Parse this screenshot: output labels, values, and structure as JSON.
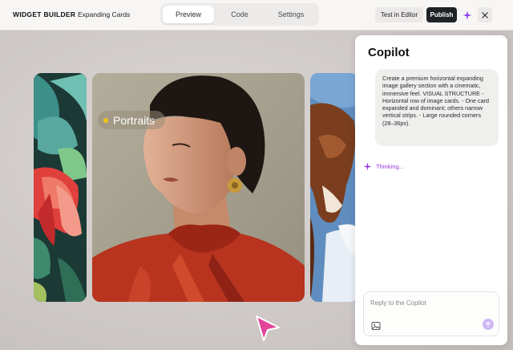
{
  "topbar": {
    "brand": "WIDGET BUILDER",
    "project": "Expanding Cards",
    "tabs": [
      {
        "label": "Preview",
        "active": true
      },
      {
        "label": "Code",
        "active": false
      },
      {
        "label": "Settings",
        "active": false
      }
    ],
    "test_label": "Test in Editor",
    "publish_label": "Publish",
    "icons": {
      "spark": "sparkle-icon",
      "close": "close-icon"
    }
  },
  "stage": {
    "cards": [
      {
        "name": "flower",
        "label": ""
      },
      {
        "name": "portrait",
        "label": "Portraits",
        "expanded": true
      },
      {
        "name": "horse",
        "label": ""
      }
    ],
    "label_dot_color": "#f2c31a"
  },
  "copilot": {
    "title": "Copilot",
    "user_message": "Create a premium horizontal expanding image gallery section with a cinematic, immersive feel.  VISUAL STRUCTURE - Horizontal row of image cards. - One card expanded and dominant; others narrow vertical strips. - Large rounded corners (28–36px).",
    "status": "Thinking...",
    "reply_placeholder": "Reply to the Copilot",
    "accent_color": "#9a3ce0"
  }
}
